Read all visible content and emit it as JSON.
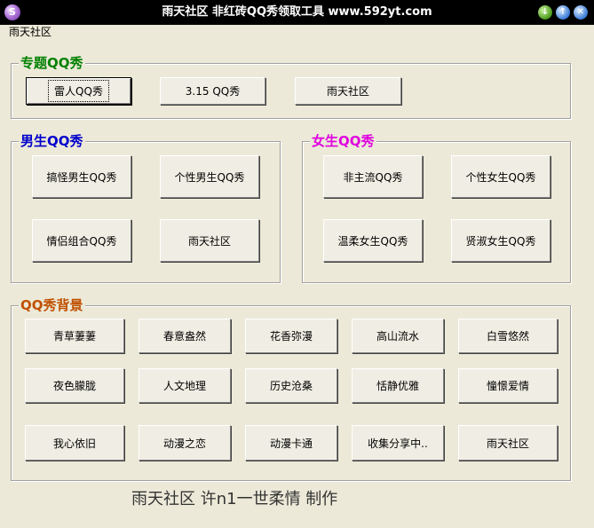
{
  "window": {
    "title": "雨天社区 非红砖QQ秀领取工具 www.592yt.com",
    "icon_glyph": "S",
    "min_glyph": "↓",
    "max_glyph": "↑",
    "close_glyph": "✕"
  },
  "menu": {
    "item": "雨天社区"
  },
  "groups": {
    "special": {
      "title": "专题QQ秀",
      "color": "#008000",
      "buttons": [
        "雷人QQ秀",
        "3.15 QQ秀",
        "雨天社区"
      ]
    },
    "male": {
      "title": "男生QQ秀",
      "color": "#0000CC",
      "buttons": [
        "搞怪男生QQ秀",
        "个性男生QQ秀",
        "情侣组合QQ秀",
        "雨天社区"
      ]
    },
    "female": {
      "title": "女生QQ秀",
      "color": "#E000E0",
      "buttons": [
        "非主流QQ秀",
        "个性女生QQ秀",
        "温柔女生QQ秀",
        "贤淑女生QQ秀"
      ]
    },
    "background": {
      "title": "QQ秀背景",
      "color": "#C05000",
      "buttons": [
        "青草萋萋",
        "春意盎然",
        "花香弥漫",
        "高山流水",
        "白雪悠然",
        "夜色朦胧",
        "人文地理",
        "历史沧桑",
        "恬静优雅",
        "憧憬爱情",
        "我心依旧",
        "动漫之恋",
        "动漫卡通",
        "收集分享中..",
        "雨天社区"
      ]
    }
  },
  "footer": "雨天社区  许n1一世柔情  制作"
}
